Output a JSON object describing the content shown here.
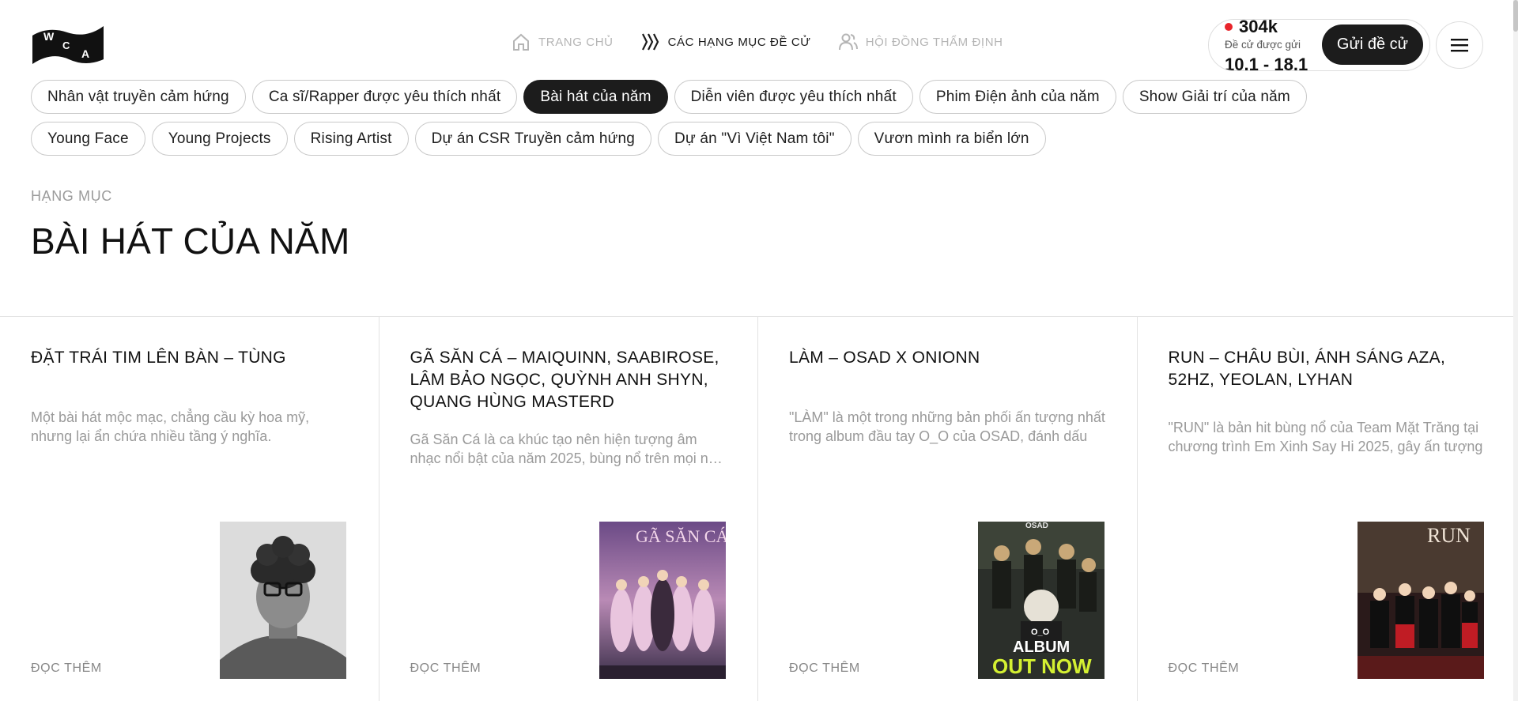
{
  "logo": {
    "letters": [
      "W",
      "C",
      "A"
    ]
  },
  "nav": [
    {
      "label": "Trang chủ",
      "icon": "home-icon",
      "active": false
    },
    {
      "label": "Các hạng mục đề cử",
      "icon": "chevrons-icon",
      "active": true
    },
    {
      "label": "Hội đồng thẩm định",
      "icon": "users-icon",
      "active": false
    }
  ],
  "submit": {
    "count": "304k",
    "count_label": "Đề cử được gửi",
    "date_range": "10.1 - 18.1",
    "button_label": "Gửi đề cử"
  },
  "menu": {
    "icon": "hamburger-icon"
  },
  "categories": {
    "row1": [
      "Nhân vật truyền cảm hứng",
      "Ca sĩ/Rapper được yêu thích nhất",
      "Bài hát của năm",
      "Diễn viên được yêu thích nhất",
      "Phim Điện ảnh của năm",
      "Show Giải trí của năm"
    ],
    "row2": [
      "Young Face",
      "Young Projects",
      "Rising Artist",
      "Dự án CSR Truyền cảm hứng",
      "Dự án \"Vì Việt Nam tôi\"",
      "Vươn mình ra biển lớn"
    ],
    "active": "Bài hát của năm"
  },
  "section": {
    "eyebrow": "Hạng mục",
    "title": "BÀI HÁT CỦA NĂM"
  },
  "cards": [
    {
      "title": "Đặt trái tim lên bàn – Tùng",
      "desc": "Một bài hát mộc mạc, chẳng cầu kỳ hoa mỹ, nhưng lại ẩn chứa nhiều tầng ý nghĩa.",
      "more": "Đọc thêm"
    },
    {
      "title": "Gã Săn Cá – MAIQUINN, SAABIROSE, LÂM BẢO NGỌC, QUỲNH ANH SHYN, QUANG HÙNG MASTERD",
      "desc": "Gã Săn Cá là ca khúc tạo nên hiện tượng âm nhạc nổi bật của năm 2025, bùng nổ trên mọi nền tảng",
      "more": "Đọc thêm",
      "poster_text": "GÃ SĂN CÁ"
    },
    {
      "title": "LÀM – OSAD x ONIONN",
      "desc": "\"LÀM\" là một trong những bản phối ấn tượng nhất trong album đầu tay O_O của OSAD, đánh dấu",
      "more": "Đọc thêm",
      "poster_text": [
        "OSAD",
        "O_O",
        "ALBUM",
        "OUT NOW"
      ]
    },
    {
      "title": "RUN – Châu Bùi, Ánh Sáng AZA, 52Hz, Yeolan, Lyhan",
      "desc": "\"RUN\" là bản hit bùng nổ của Team Mặt Trăng tại chương trình Em Xinh Say Hi 2025, gây ấn tượng",
      "more": "Đọc thêm",
      "poster_text": "RUN"
    }
  ],
  "colors": {
    "active_bg": "#1c1c1c",
    "muted": "#9a9a9a",
    "border": "#c9c9c9",
    "accent_red": "#e8242a",
    "poster_yellow": "#d4f032"
  }
}
